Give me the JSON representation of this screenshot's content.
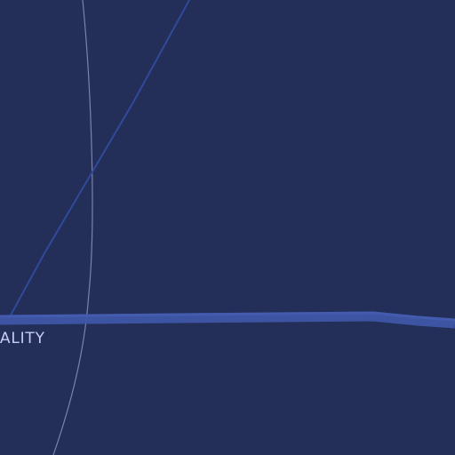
{
  "map": {
    "colors": {
      "background": "#232f59",
      "major_road": "#3f56a6",
      "minor_road": "#2f4a9c",
      "boundary": "#8a93b8",
      "label": "#c7cdf3"
    },
    "labels": {
      "place": "RALITY"
    }
  }
}
